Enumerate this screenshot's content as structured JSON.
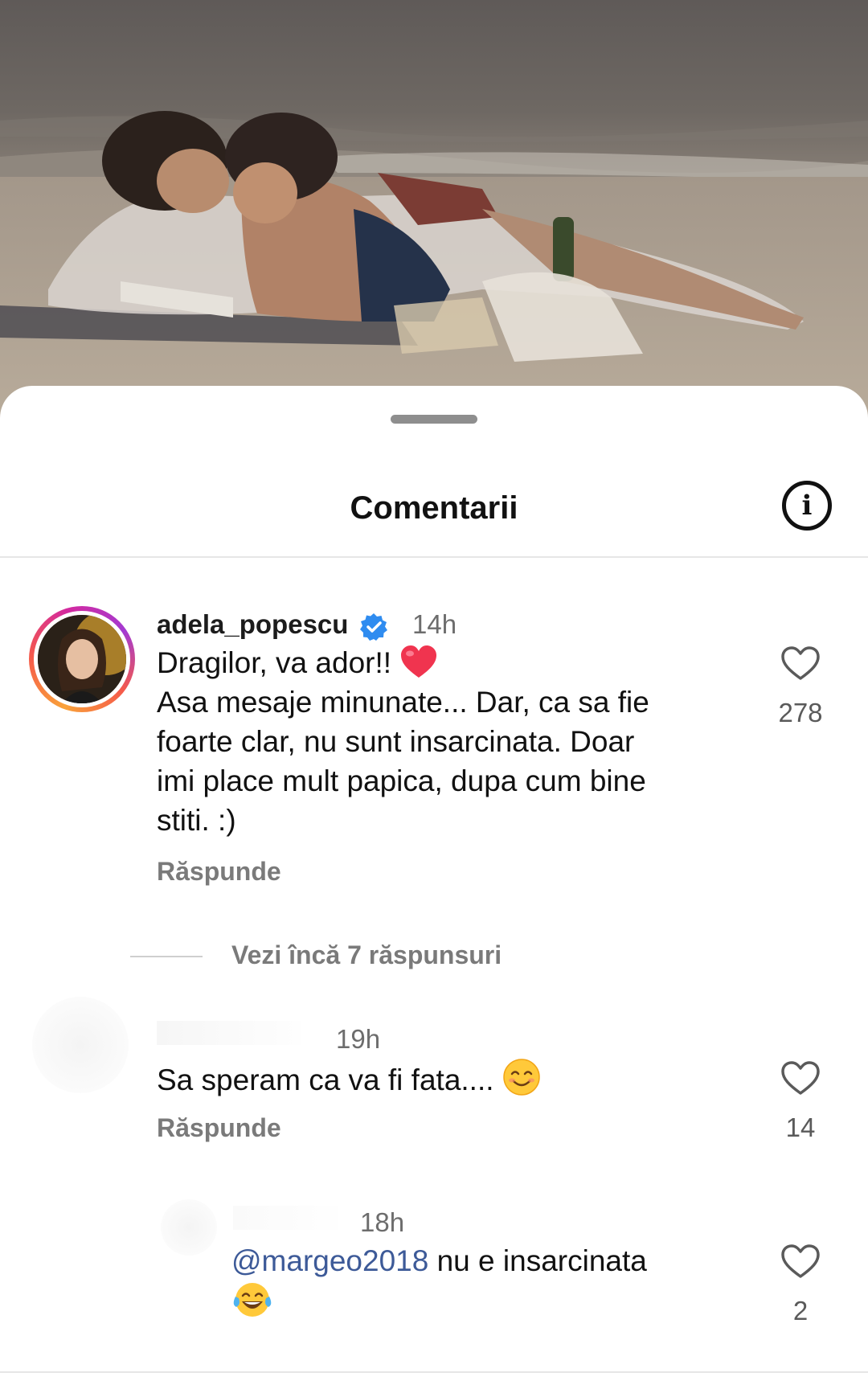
{
  "sheet": {
    "title": "Comentarii",
    "info_icon": "info-circle-icon"
  },
  "comments": [
    {
      "username": "adela_popescu",
      "verified": true,
      "time": "14h",
      "lines": [
        "Dragilor, va ador!!",
        "Asa mesaje minunate... Dar, ca sa fie",
        "foarte clar, nu sunt insarcinata. Doar",
        "imi place mult papica, dupa cum bine",
        "stiti. :)"
      ],
      "emoji": "red-heart-emoji",
      "reply_label": "Răspunde",
      "likes": "278",
      "more_replies": "Vezi încă 7 răspunsuri"
    },
    {
      "time": "19h",
      "text": "Sa speram ca va fi fata....",
      "emoji": "smiling-face-emoji",
      "reply_label": "Răspunde",
      "likes": "14"
    },
    {
      "time": "18h",
      "mention": "@margeo2018",
      "text": " nu e insarcinata",
      "emoji": "tears-of-joy-emoji",
      "likes": "2"
    }
  ],
  "colors": {
    "mention": "#3d5a98",
    "verified": "#2f8cf0",
    "heart_emoji": "#f0344f",
    "secondary_text": "#6d6d6d"
  }
}
